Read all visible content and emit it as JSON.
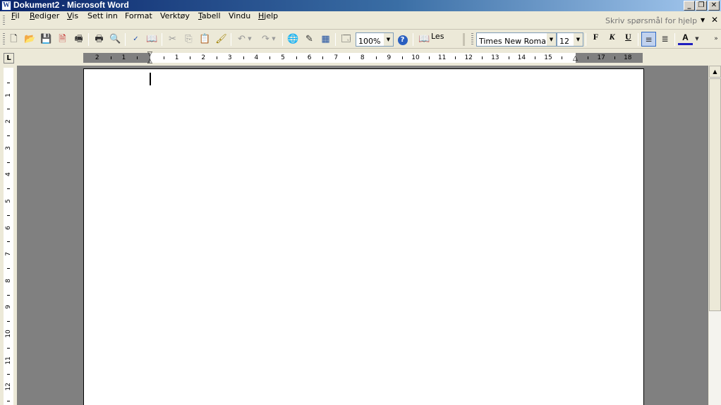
{
  "window": {
    "title": "Dokument2 - Microsoft Word",
    "app_icon_label": "W",
    "min_label": "_",
    "max_label": "❐",
    "close_label": "✕"
  },
  "menu": {
    "items": [
      "Fil",
      "Rediger",
      "Vis",
      "Sett inn",
      "Format",
      "Verktøy",
      "Tabell",
      "Vindu",
      "Hjelp"
    ],
    "help_placeholder": "Skriv spørsmål for hjelp",
    "doc_close_label": "✕"
  },
  "toolbar": {
    "icons": [
      "new-document",
      "open",
      "save",
      "permission",
      "print-preview-alt",
      "print",
      "print-preview",
      "spelling",
      "research",
      "cut",
      "copy",
      "paste",
      "format-painter",
      "undo",
      "redo",
      "hyperlink",
      "tables-borders",
      "insert-table",
      "document-map",
      "help"
    ],
    "zoom_value": "100%",
    "read_label": "Les",
    "font_name": "Times New Roman",
    "font_size": "12",
    "bold_label": "F",
    "italic_label": "K",
    "underline_label": "U",
    "font_color_label": "A",
    "font_color": "#1f1fbf"
  },
  "ruler": {
    "tab_selector_label": "L",
    "horizontal_left_numbers": [
      "2",
      "1"
    ],
    "horizontal_numbers": [
      "1",
      "2",
      "3",
      "4",
      "5",
      "6",
      "7",
      "8",
      "9",
      "10",
      "11",
      "12",
      "13",
      "14",
      "15",
      "17",
      "18"
    ],
    "vertical_numbers": [
      "1",
      "1",
      "2",
      "3",
      "4",
      "5",
      "6",
      "7",
      "8",
      "9",
      "10",
      "11",
      "12"
    ]
  }
}
